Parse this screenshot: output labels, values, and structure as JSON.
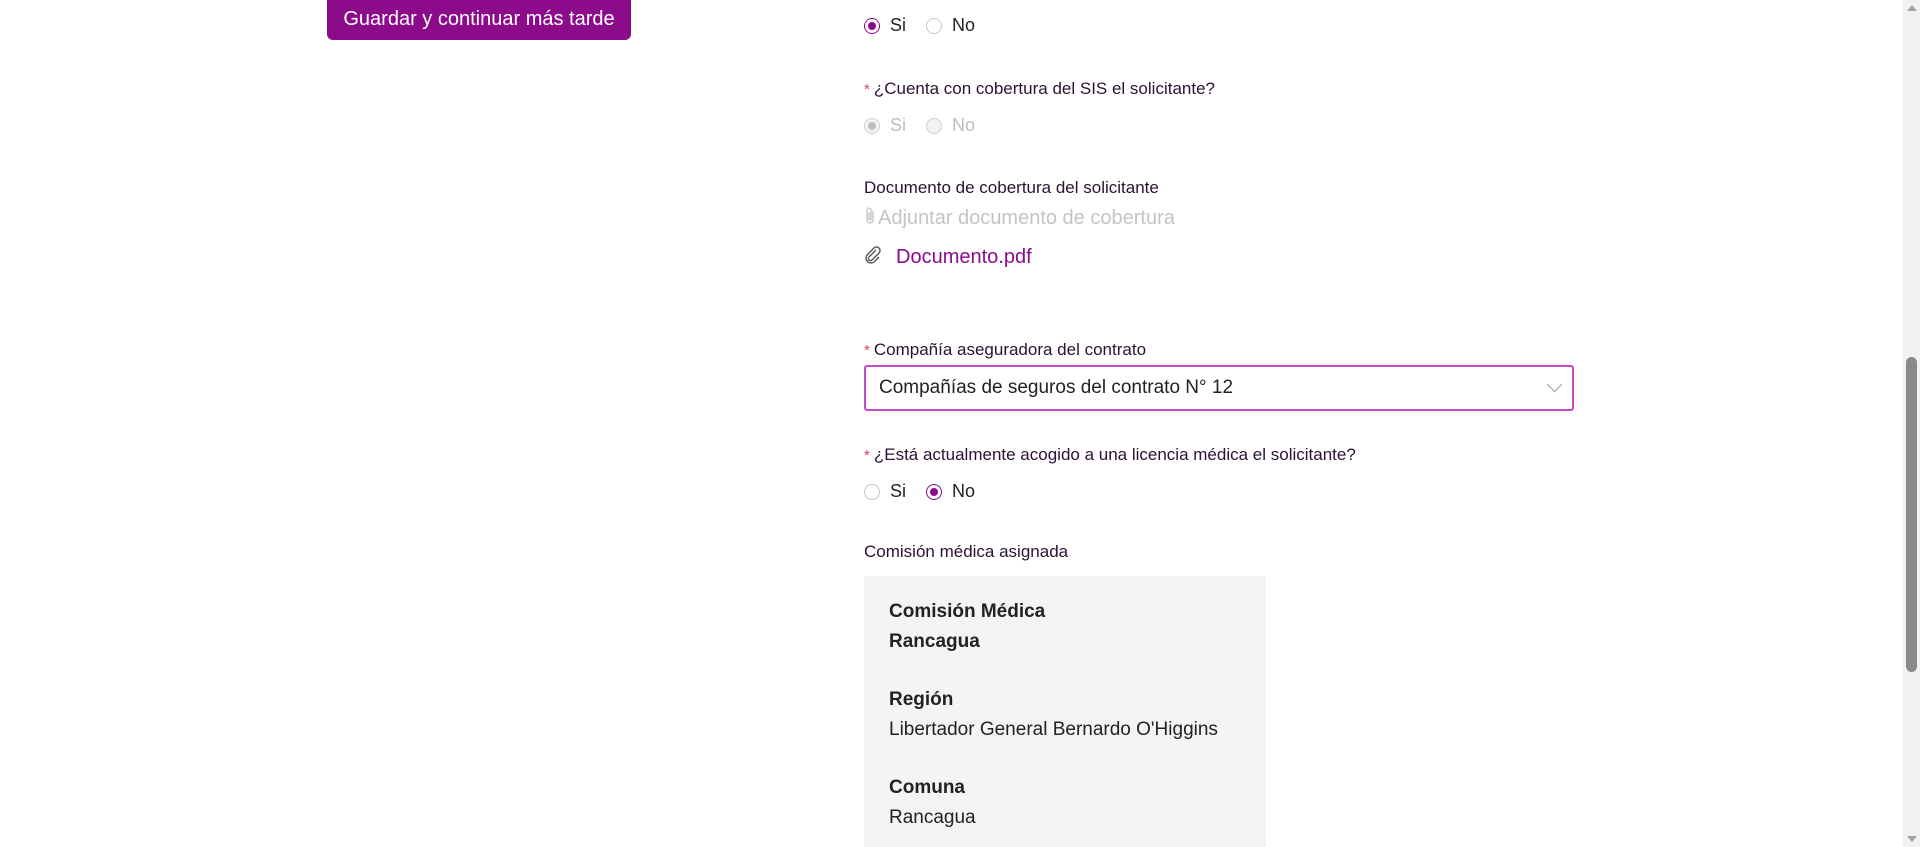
{
  "actions": {
    "save_later_label": "Guardar y continuar más tarde"
  },
  "q_top": {
    "options": [
      "Si",
      "No"
    ],
    "selected": "Si"
  },
  "q_sis": {
    "label": "¿Cuenta con cobertura del SIS el solicitante?",
    "options": [
      "Si",
      "No"
    ],
    "selected": "Si",
    "disabled": true
  },
  "coverage_doc": {
    "label": "Documento de cobertura del solicitante",
    "placeholder": "Adjuntar documento de cobertura",
    "file_name": "Documento.pdf"
  },
  "insurer": {
    "label": "Compañía aseguradora del contrato",
    "value": "Compañías de seguros del contrato N° 12"
  },
  "q_license": {
    "label": "¿Está actualmente acogido a una licencia médica el solicitante?",
    "options": [
      "Si",
      "No"
    ],
    "selected": "No"
  },
  "commission": {
    "label": "Comisión médica asignada",
    "name": "Comisión Médica Rancagua",
    "region_label": "Región",
    "region_value": "Libertador General Bernardo O'Higgins",
    "comuna_label": "Comuna",
    "comuna_value": "Rancagua"
  },
  "colors": {
    "accent": "#8b0b8b",
    "required": "#e0406a",
    "select_border": "#c44bc4"
  }
}
